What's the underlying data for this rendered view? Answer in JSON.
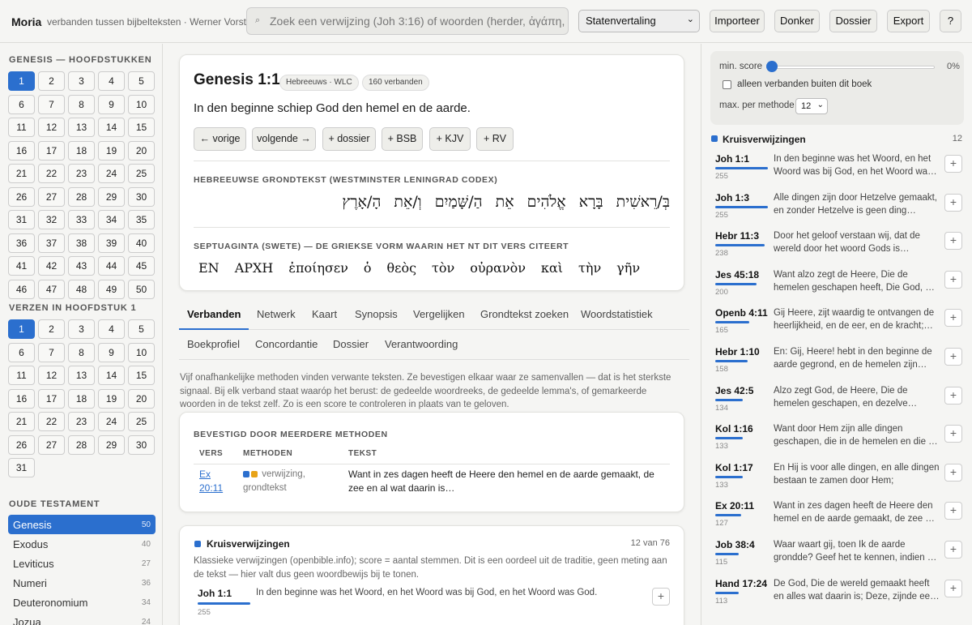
{
  "app": {
    "name": "Moria",
    "tagline": "verbanden tussen bijbelteksten · Werner Vorstman"
  },
  "search": {
    "placeholder": "Zoek een verwijzing (Joh 3:16) of woorden (herder, ἀγάπη, H7225)"
  },
  "translation": {
    "selected": "Statenvertaling"
  },
  "toolbar": {
    "import": "Importeer",
    "dark": "Donker",
    "dossier": "Dossier",
    "export": "Export",
    "help": "?"
  },
  "chapters": {
    "heading": "GENESIS — HOOFDSTUKKEN",
    "numbers": [
      "1",
      "2",
      "3",
      "4",
      "5",
      "6",
      "7",
      "8",
      "9",
      "10",
      "11",
      "12",
      "13",
      "14",
      "15",
      "16",
      "17",
      "18",
      "19",
      "20",
      "21",
      "22",
      "23",
      "24",
      "25",
      "26",
      "27",
      "28",
      "29",
      "30",
      "31",
      "32",
      "33",
      "34",
      "35",
      "36",
      "37",
      "38",
      "39",
      "40",
      "41",
      "42",
      "43",
      "44",
      "45",
      "46",
      "47",
      "48",
      "49",
      "50"
    ],
    "active": "1"
  },
  "verses": {
    "heading": "VERZEN IN HOOFDSTUK 1",
    "numbers": [
      "1",
      "2",
      "3",
      "4",
      "5",
      "6",
      "7",
      "8",
      "9",
      "10",
      "11",
      "12",
      "13",
      "14",
      "15",
      "16",
      "17",
      "18",
      "19",
      "20",
      "21",
      "22",
      "23",
      "24",
      "25",
      "26",
      "27",
      "28",
      "29",
      "30",
      "31"
    ],
    "active": "1"
  },
  "ot": {
    "heading": "OUDE TESTAMENT",
    "books": [
      {
        "name": "Genesis",
        "count": "50",
        "active": true
      },
      {
        "name": "Exodus",
        "count": "40"
      },
      {
        "name": "Leviticus",
        "count": "27"
      },
      {
        "name": "Numeri",
        "count": "36"
      },
      {
        "name": "Deuteronomium",
        "count": "34"
      },
      {
        "name": "Jozua",
        "count": "24"
      }
    ]
  },
  "verse": {
    "title": "Genesis 1:1",
    "badge_source": "Hebreeuws · WLC",
    "badge_links": "160 verbanden",
    "text": "In den beginne schiep God den hemel en de aarde.",
    "buttons": [
      "← vorige",
      "volgende →",
      "+ dossier",
      "+ BSB",
      "+ KJV",
      "+ RV"
    ],
    "hebrew_heading": "HEBREEUWSE GRONDTEKST (WESTMINSTER LENINGRAD CODEX)",
    "hebrew": "בְּ/רֵאשִׁית בָּרָא אֱלֹהִים אֵת הַ/שָּׁמַיִם וְ/אֵת הָ/אָרֶץ",
    "greek_heading": "SEPTUAGINTA (SWETE) — DE GRIEKSE VORM WAARIN HET NT DIT VERS CITEERT",
    "greek": [
      "ΕΝ",
      "ΑΡΧΗ",
      "ἐποίησεν",
      "ὁ",
      "θεὸς",
      "τὸν",
      "οὐρανὸν",
      "καὶ",
      "τὴν",
      "γῆν"
    ]
  },
  "tabs": {
    "row1": [
      "Verbanden",
      "Netwerk",
      "Kaart",
      "Synopsis",
      "Vergelijken",
      "Grondtekst zoeken",
      "Woordstatistiek"
    ],
    "row2": [
      "Boekprofiel",
      "Concordantie",
      "Dossier",
      "Verantwoording"
    ]
  },
  "description": "Vijf onafhankelijke methoden vinden verwante teksten. Ze bevestigen elkaar waar ze samenvallen — dat is het sterkste signaal. Bij elk verband staat waaróp het berust: de gedeelde woordreeks, de gedeelde lemma's, of gemarkeerde woorden in de tekst zelf. Zo is een score te controleren in plaats van te geloven.",
  "confirmed": {
    "heading": "BEVESTIGD DOOR MEERDERE METHODEN",
    "columns": [
      "VERS",
      "METHODEN",
      "TEKST"
    ],
    "rows": [
      {
        "ref_line1": "Ex",
        "ref_line2": "20:11",
        "methods": "verwijzing, grondtekst",
        "text": "Want in zes dagen heeft de Heere den hemel en de aarde gemaakt, de zee en al wat daarin is…"
      }
    ]
  },
  "crossrefs": {
    "heading": "Kruisverwijzingen",
    "count": "12 van 76",
    "description": "Klassieke verwijzingen (openbible.info); score = aantal stemmen. Dit is een oordeel uit de traditie, geen meting aan de tekst — hier valt dus geen woordbewijs bij te tonen.",
    "first": {
      "ref": "Joh 1:1",
      "score": "255",
      "text": "In den beginne was het Woord, en het Woord was bij God, en het Woord was God."
    }
  },
  "filters": {
    "min_score_label": "min. score",
    "min_score_value": "0%",
    "outside_book_label": "alleen verbanden buiten dit boek",
    "max_label": "max. per methode",
    "max_value": "12"
  },
  "right_panel": {
    "heading": "Kruisverwijzingen",
    "count": "12",
    "items": [
      {
        "ref": "Joh 1:1",
        "score": "255",
        "text": "In den beginne was het Woord, en het Woord was bij God, en het Woord was God."
      },
      {
        "ref": "Joh 1:3",
        "score": "255",
        "text": "Alle dingen zijn door Hetzelve gemaakt, en zonder Hetzelve is geen ding gemaakt, dat gemaakt is."
      },
      {
        "ref": "Hebr 11:3",
        "score": "238",
        "text": "Door het geloof verstaan wij, dat de wereld door het woord Gods is toebereid, alzo dat de dingen."
      },
      {
        "ref": "Jes 45:18",
        "score": "200",
        "text": "Want alzo zegt de Heere, Die de hemelen geschapen heeft, Die God, Die de aarde geformeerd heeft."
      },
      {
        "ref": "Openb 4:11",
        "score": "165",
        "text": "Gij Heere, zijt waardig te ontvangen de heerlijkheid, en de eer, en de kracht; want Gij hebt."
      },
      {
        "ref": "Hebr 1:10",
        "score": "158",
        "text": "En: Gij, Heere! hebt in den beginne de aarde gegrond, en de hemelen zijn werken Uwer handen."
      },
      {
        "ref": "Jes 42:5",
        "score": "134",
        "text": "Alzo zegt God, de Heere, Die de hemelen geschapen, en dezelve uitgebreid heeft, Die de aarde."
      },
      {
        "ref": "Kol 1:16",
        "score": "133",
        "text": "Want door Hem zijn alle dingen geschapen, die in de hemelen en die op de aarde zijn."
      },
      {
        "ref": "Kol 1:17",
        "score": "133",
        "text": "En Hij is voor alle dingen, en alle dingen bestaan te zamen door Hem;"
      },
      {
        "ref": "Ex 20:11",
        "score": "127",
        "text": "Want in zes dagen heeft de Heere den hemel en de aarde gemaakt, de zee en al wat daarin is."
      },
      {
        "ref": "Job 38:4",
        "score": "115",
        "text": "Waar waart gij, toen Ik de aarde grondde? Geef het te kennen, indien gij kloek van verstand zijt."
      },
      {
        "ref": "Hand 17:24",
        "score": "113",
        "text": "De God, Die de wereld gemaakt heeft en alles wat daarin is; Deze, zijnde een Heere des hemels."
      }
    ]
  },
  "colors": {
    "accent": "#2b6fce",
    "method_grondtekst": "#e8a317"
  }
}
